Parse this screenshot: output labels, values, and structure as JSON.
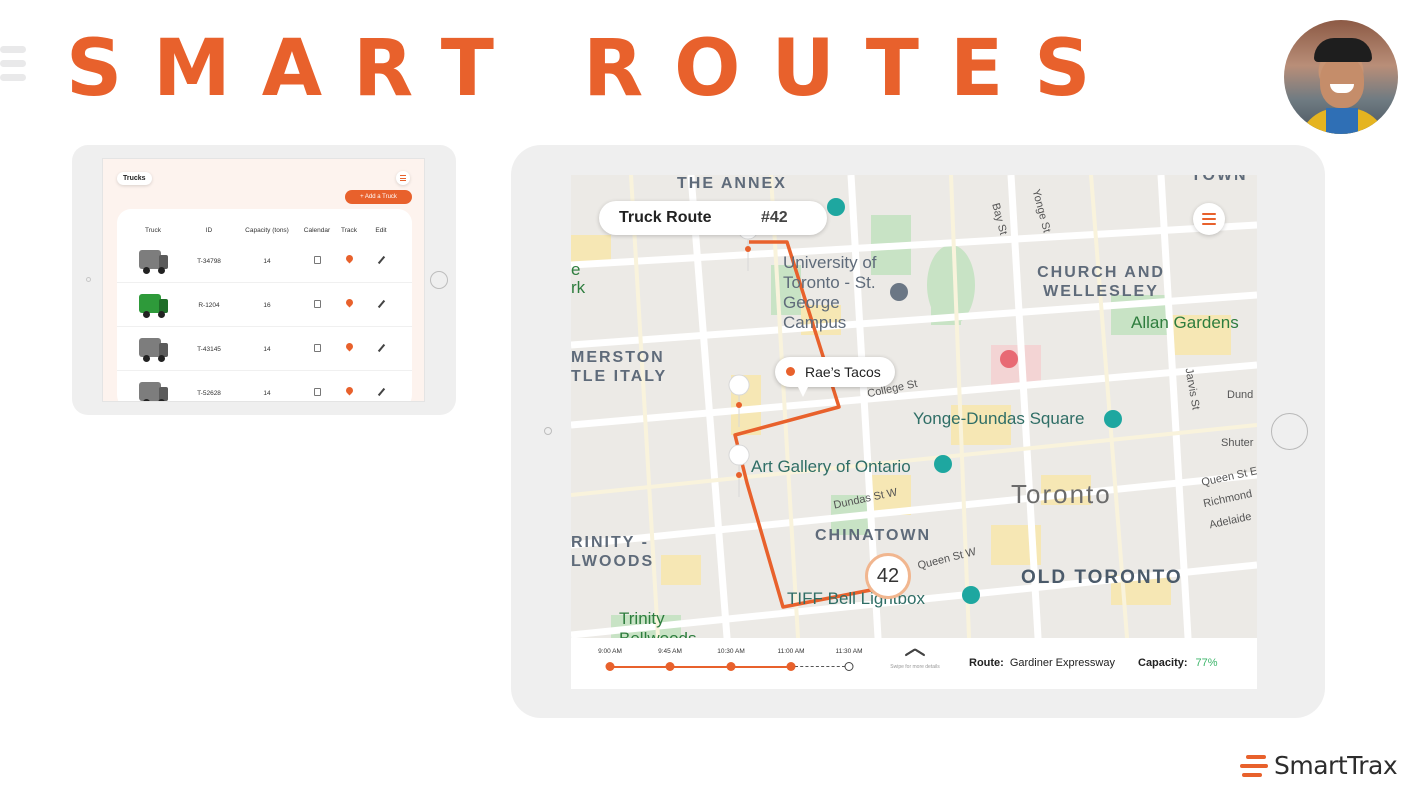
{
  "header": {
    "title": "SMART ROUTES"
  },
  "trucks_screen": {
    "tab_label": "Trucks",
    "add_button": "+ Add a Truck",
    "columns": [
      "Truck",
      "ID",
      "Capacity (tons)",
      "Calendar",
      "Track",
      "Edit"
    ],
    "rows": [
      {
        "id": "T-34798",
        "capacity": "14"
      },
      {
        "id": "R-1204",
        "capacity": "16"
      },
      {
        "id": "T-43145",
        "capacity": "14"
      },
      {
        "id": "T-52628",
        "capacity": "14"
      }
    ]
  },
  "route_screen": {
    "chip_label": "Truck Route",
    "chip_number": "#42",
    "stop_popup": "Rae’s Tacos",
    "truck_marker": "42",
    "map_labels": {
      "annex": "THE ANNEX",
      "uoft": "University of Toronto - St. George Campus",
      "church": "CHURCH AND WELLESLEY",
      "allan": "Allan Gardens",
      "merston": "MERSTON",
      "little_italy": "TLE ITALY",
      "yonge_dundas": "Yonge-Dundas Square",
      "ago": "Art Gallery of Ontario",
      "toronto": "Toronto",
      "chinatown": "CHINATOWN",
      "trinity_area": "RINITY - LWOODS",
      "old_toronto": "OLD TORONTO",
      "tiff": "TIFF Bell Lightbox",
      "trinity_park": "Trinity Bellwoods",
      "college": "College St",
      "dundas": "Dundas St W",
      "queen": "Queen St W",
      "bay": "Bay St",
      "yonge": "Yonge St",
      "jarvis": "Jarvis St",
      "town": "TOWN",
      "park_edge": "e rk",
      "dund": "Dund",
      "shuter": "Shuter",
      "queen_e": "Queen St E",
      "richmond": "Richmond",
      "adelaide": "Adelaide"
    },
    "timeline": [
      "9:00 AM",
      "9:45 AM",
      "10:30 AM",
      "11:00 AM",
      "11:30 AM"
    ],
    "swipe_hint": "Swipe for more details",
    "route_label": "Route:",
    "route_value": "Gardiner Expressway",
    "capacity_label": "Capacity:",
    "capacity_value": "77%"
  },
  "logo": {
    "text": "SmartTrax"
  },
  "colors": {
    "brand": "#e8612c",
    "capacity_good": "#3cb56a"
  },
  "icons": [
    "hamburger-menu-icon",
    "calendar-icon",
    "location-pin-icon",
    "pencil-icon",
    "chevron-up-icon",
    "hospital-icon",
    "museum-icon",
    "school-icon",
    "cinema-icon"
  ]
}
